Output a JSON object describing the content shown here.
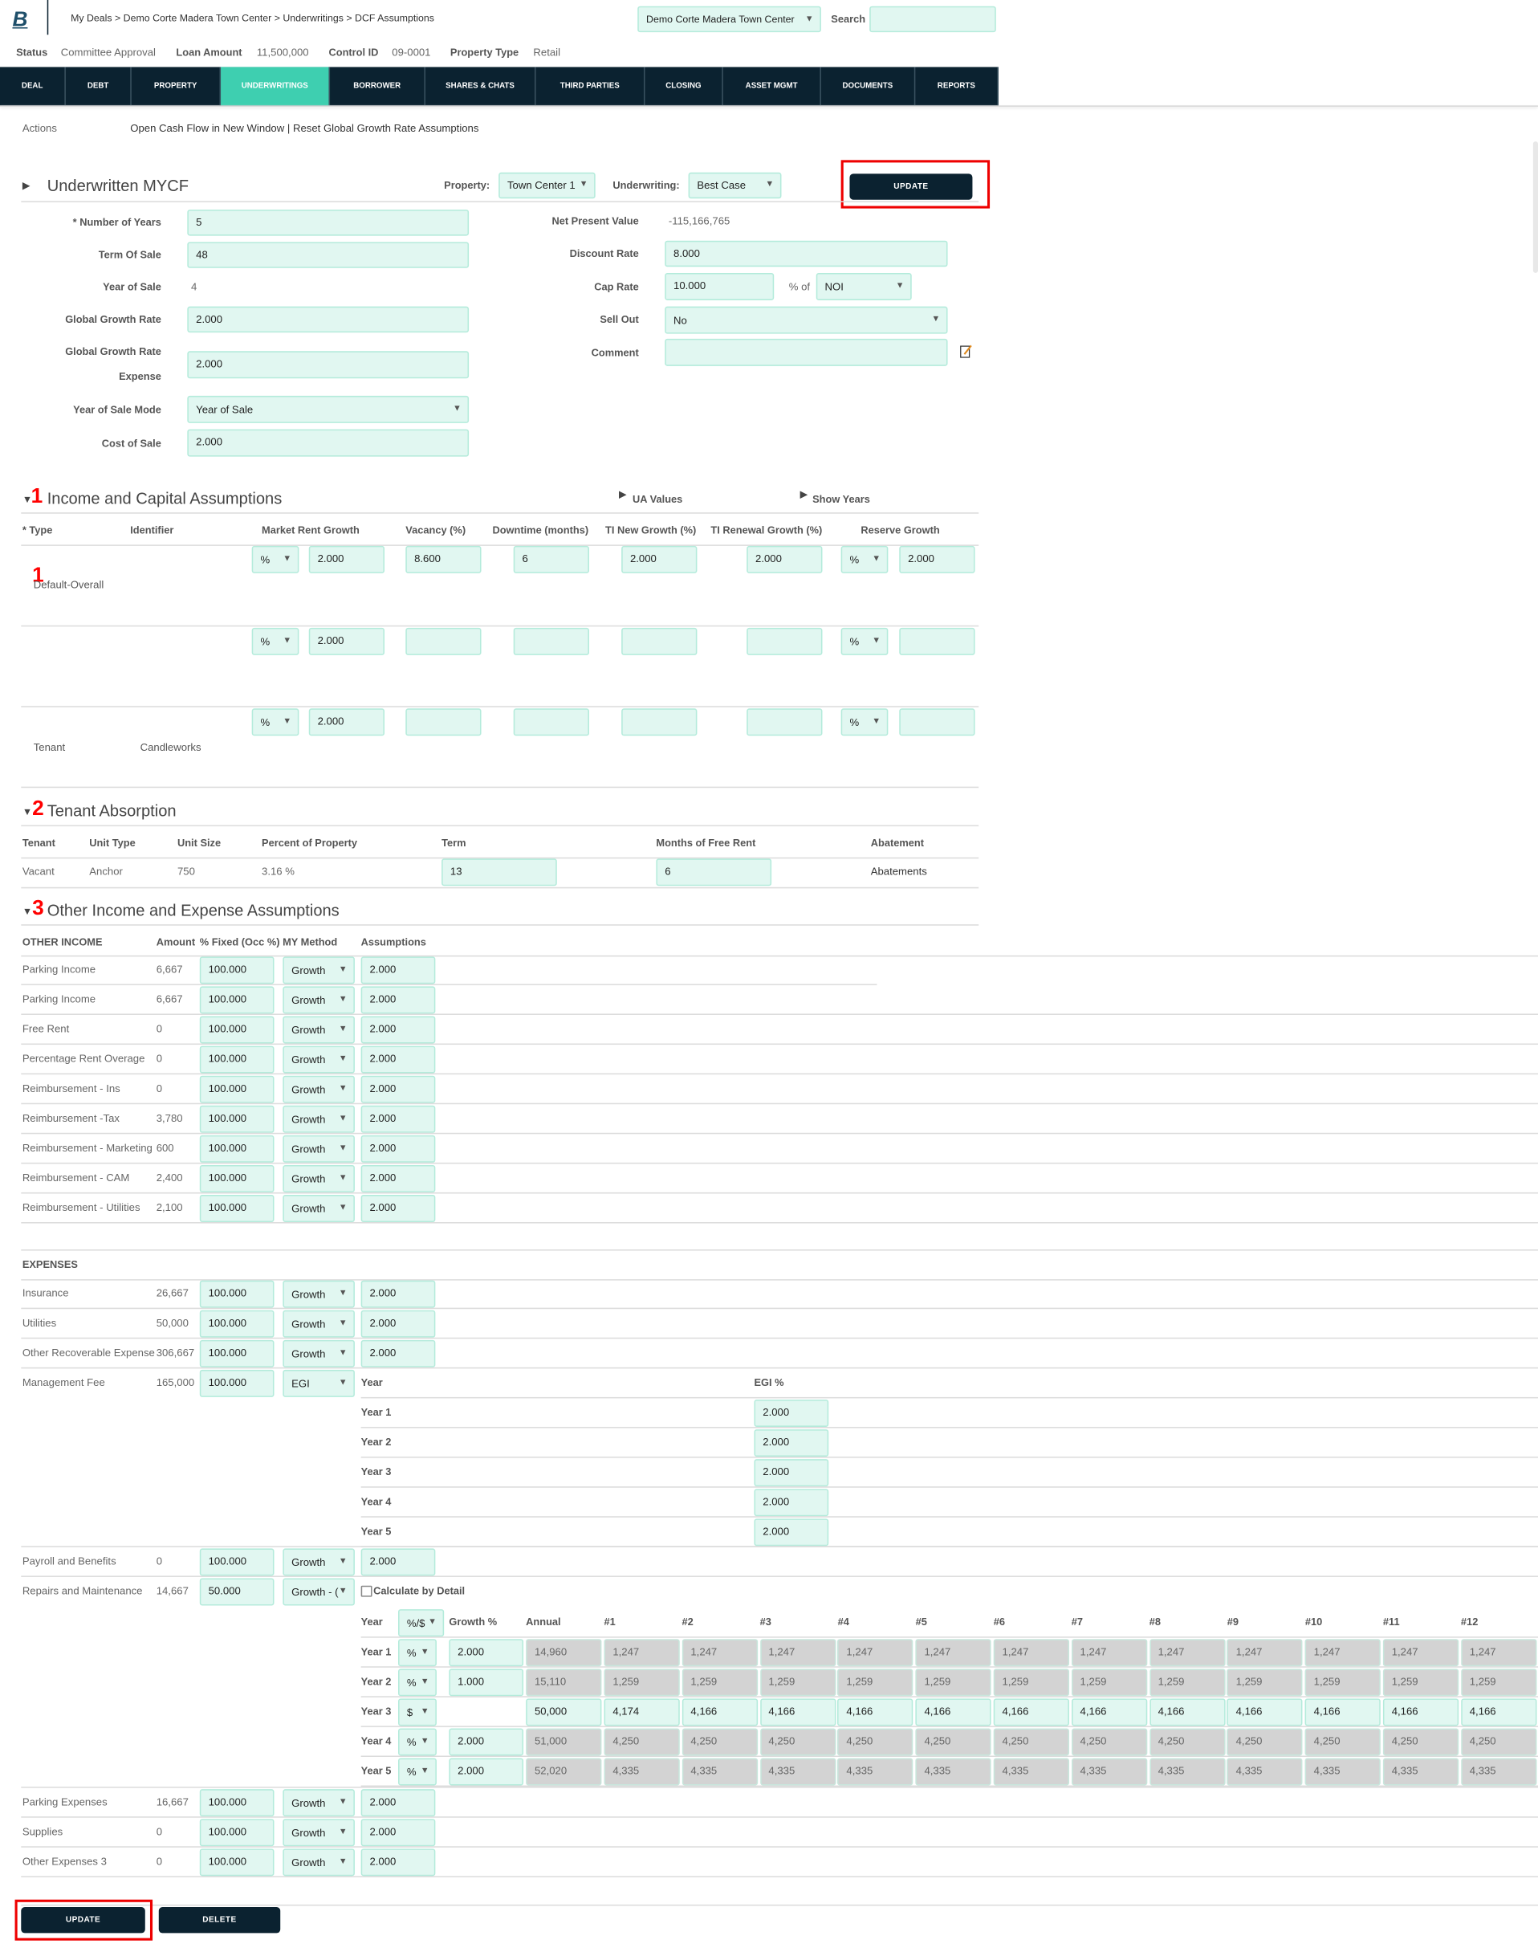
{
  "header": {
    "logo": "B",
    "breadcrumb": "My Deals > Demo Corte Madera Town Center > Underwritings > DCF Assumptions",
    "deal_select": "Demo Corte Madera Town Center",
    "search_label": "Search",
    "search_value": ""
  },
  "status_bar": {
    "status_label": "Status",
    "status_value": "Committee Approval",
    "loan_label": "Loan Amount",
    "loan_value": "11,500,000",
    "control_label": "Control ID",
    "control_value": "09-0001",
    "type_label": "Property Type",
    "type_value": "Retail"
  },
  "nav": {
    "tabs": [
      "DEAL",
      "DEBT",
      "PROPERTY",
      "UNDERWRITINGS",
      "BORROWER",
      "SHARES & CHATS",
      "THIRD PARTIES",
      "CLOSING",
      "ASSET MGMT",
      "DOCUMENTS",
      "REPORTS"
    ],
    "active": "UNDERWRITINGS"
  },
  "actions": {
    "label": "Actions",
    "open_cash_flow": "Open Cash Flow in New Window",
    "separator": "|",
    "reset_growth": "Reset Global Growth Rate Assumptions"
  },
  "mycf": {
    "title": "Underwritten MYCF",
    "property_label": "Property:",
    "property_value": "Town Center 1",
    "underwriting_label": "Underwriting:",
    "underwriting_value": "Best Case",
    "update_label": "UPDATE",
    "number_of_years_label": "* Number of Years",
    "number_of_years": "5",
    "term_of_sale_label": "Term Of Sale",
    "term_of_sale": "48",
    "year_of_sale_label": "Year of Sale",
    "year_of_sale": "4",
    "global_growth_label": "Global Growth Rate",
    "global_growth": "2.000",
    "global_growth_exp_label_1": "Global Growth Rate",
    "global_growth_exp_label_2": "Expense",
    "global_growth_exp": "2.000",
    "year_of_sale_mode_label": "Year of Sale Mode",
    "year_of_sale_mode": "Year of Sale",
    "cost_of_sale_label": "Cost of Sale",
    "cost_of_sale": "2.000",
    "npv_label": "Net Present Value",
    "npv": "-115,166,765",
    "discount_rate_label": "Discount Rate",
    "discount_rate": "8.000",
    "cap_rate_label": "Cap Rate",
    "cap_rate": "10.000",
    "cap_rate_of": "% of",
    "cap_rate_basis": "NOI",
    "sell_out_label": "Sell Out",
    "sell_out": "No",
    "comment_label": "Comment",
    "comment": "",
    "comment_icon": "edit-note-icon"
  },
  "annotations": {
    "one_a": "1",
    "one_b": "1",
    "two": "2",
    "three": "3"
  },
  "income_capital": {
    "title": "Income and Capital Assumptions",
    "ua_values": "UA Values",
    "show_years": "Show Years",
    "headers": [
      "* Type",
      "Identifier",
      "Market Rent Growth",
      "Vacancy (%)",
      "Downtime (months)",
      "TI New Growth (%)",
      "TI Renewal Growth (%)",
      "Reserve Growth"
    ],
    "rows": [
      {
        "type": "Default-Overall",
        "identifier": "",
        "mrg_unit": "%",
        "mrg": "2.000",
        "vacancy": "8.600",
        "downtime": "6",
        "ti_new": "2.000",
        "ti_renewal": "2.000",
        "reserve_unit": "%",
        "reserve": "2.000"
      },
      {
        "type": "",
        "identifier": "",
        "mrg_unit": "%",
        "mrg": "2.000",
        "vacancy": "",
        "downtime": "",
        "ti_new": "",
        "ti_renewal": "",
        "reserve_unit": "%",
        "reserve": ""
      },
      {
        "type": "Tenant",
        "identifier": "Candleworks",
        "mrg_unit": "%",
        "mrg": "2.000",
        "vacancy": "",
        "downtime": "",
        "ti_new": "",
        "ti_renewal": "",
        "reserve_unit": "%",
        "reserve": ""
      }
    ]
  },
  "tenant_absorption": {
    "title": "Tenant Absorption",
    "headers": [
      "Tenant",
      "Unit Type",
      "Unit Size",
      "Percent of Property",
      "Term",
      "Months of Free Rent",
      "Abatement"
    ],
    "row": {
      "tenant": "Vacant",
      "unit_type": "Anchor",
      "unit_size": "750",
      "percent": "3.16 %",
      "term": "13",
      "free_rent": "6",
      "abatement": "Abatements"
    }
  },
  "other_income_expense": {
    "title": "Other Income and Expense Assumptions",
    "income_header": "OTHER INCOME",
    "col_amount": "Amount",
    "col_fixed_method": "% Fixed (Occ %) MY Method",
    "col_assumptions": "Assumptions",
    "income": [
      {
        "name": "Parking Income",
        "amount": "6,667",
        "fixed": "100.000",
        "method": "Growth",
        "assumption": "2.000"
      },
      {
        "name": "Parking Income",
        "amount": "6,667",
        "fixed": "100.000",
        "method": "Growth",
        "assumption": "2.000"
      },
      {
        "name": "Free Rent",
        "amount": "0",
        "fixed": "100.000",
        "method": "Growth",
        "assumption": "2.000"
      },
      {
        "name": "Percentage Rent Overage",
        "amount": "0",
        "fixed": "100.000",
        "method": "Growth",
        "assumption": "2.000"
      },
      {
        "name": "Reimbursement - Ins",
        "amount": "0",
        "fixed": "100.000",
        "method": "Growth",
        "assumption": "2.000"
      },
      {
        "name": "Reimbursement -Tax",
        "amount": "3,780",
        "fixed": "100.000",
        "method": "Growth",
        "assumption": "2.000"
      },
      {
        "name": "Reimbursement - Marketing",
        "amount": "600",
        "fixed": "100.000",
        "method": "Growth",
        "assumption": "2.000"
      },
      {
        "name": "Reimbursement - CAM",
        "amount": "2,400",
        "fixed": "100.000",
        "method": "Growth",
        "assumption": "2.000"
      },
      {
        "name": "Reimbursement - Utilities",
        "amount": "2,100",
        "fixed": "100.000",
        "method": "Growth",
        "assumption": "2.000"
      }
    ],
    "expenses_header": "EXPENSES",
    "expenses_a": [
      {
        "name": "Insurance",
        "amount": "26,667",
        "fixed": "100.000",
        "method": "Growth",
        "assumption": "2.000"
      },
      {
        "name": "Utilities",
        "amount": "50,000",
        "fixed": "100.000",
        "method": "Growth",
        "assumption": "2.000"
      },
      {
        "name": "Other Recoverable Expense",
        "amount": "306,667",
        "fixed": "100.000",
        "method": "Growth",
        "assumption": "2.000"
      }
    ],
    "management_fee": {
      "name": "Management Fee",
      "amount": "165,000",
      "fixed": "100.000",
      "method": "EGI",
      "year_header": "Year",
      "egi_header": "EGI %",
      "years": [
        {
          "year": "Year 1",
          "egi": "2.000"
        },
        {
          "year": "Year 2",
          "egi": "2.000"
        },
        {
          "year": "Year 3",
          "egi": "2.000"
        },
        {
          "year": "Year 4",
          "egi": "2.000"
        },
        {
          "year": "Year 5",
          "egi": "2.000"
        }
      ]
    },
    "payroll": {
      "name": "Payroll and Benefits",
      "amount": "0",
      "fixed": "100.000",
      "method": "Growth",
      "assumption": "2.000"
    },
    "repairs": {
      "name": "Repairs and Maintenance",
      "amount": "14,667",
      "fixed": "50.000",
      "method": "Growth - (",
      "calc_by_detail_label": "Calculate by Detail",
      "calc_by_detail_checked": false,
      "detail": {
        "headers": {
          "year": "Year",
          "mode": "%/$",
          "growth": "Growth %",
          "annual": "Annual",
          "months": [
            "#1",
            "#2",
            "#3",
            "#4",
            "#5",
            "#6",
            "#7",
            "#8",
            "#9",
            "#10",
            "#11",
            "#12"
          ]
        },
        "rows": [
          {
            "year": "Year 1",
            "mode": "%",
            "growth": "2.000",
            "annual": "14,960",
            "editable": false,
            "months": [
              "1,247",
              "1,247",
              "1,247",
              "1,247",
              "1,247",
              "1,247",
              "1,247",
              "1,247",
              "1,247",
              "1,247",
              "1,247",
              "1,247"
            ]
          },
          {
            "year": "Year 2",
            "mode": "%",
            "growth": "1.000",
            "annual": "15,110",
            "editable": false,
            "months": [
              "1,259",
              "1,259",
              "1,259",
              "1,259",
              "1,259",
              "1,259",
              "1,259",
              "1,259",
              "1,259",
              "1,259",
              "1,259",
              "1,259"
            ]
          },
          {
            "year": "Year 3",
            "mode": "$",
            "growth": "",
            "annual": "50,000",
            "editable": true,
            "months": [
              "4,174",
              "4,166",
              "4,166",
              "4,166",
              "4,166",
              "4,166",
              "4,166",
              "4,166",
              "4,166",
              "4,166",
              "4,166",
              "4,166"
            ]
          },
          {
            "year": "Year 4",
            "mode": "%",
            "growth": "2.000",
            "annual": "51,000",
            "editable": false,
            "months": [
              "4,250",
              "4,250",
              "4,250",
              "4,250",
              "4,250",
              "4,250",
              "4,250",
              "4,250",
              "4,250",
              "4,250",
              "4,250",
              "4,250"
            ]
          },
          {
            "year": "Year 5",
            "mode": "%",
            "growth": "2.000",
            "annual": "52,020",
            "editable": false,
            "months": [
              "4,335",
              "4,335",
              "4,335",
              "4,335",
              "4,335",
              "4,335",
              "4,335",
              "4,335",
              "4,335",
              "4,335",
              "4,335",
              "4,335"
            ]
          }
        ]
      }
    },
    "expenses_b": [
      {
        "name": "Parking Expenses",
        "amount": "16,667",
        "fixed": "100.000",
        "method": "Growth",
        "assumption": "2.000"
      },
      {
        "name": "Supplies",
        "amount": "0",
        "fixed": "100.000",
        "method": "Growth",
        "assumption": "2.000"
      },
      {
        "name": "Other Expenses 3",
        "amount": "0",
        "fixed": "100.000",
        "method": "Growth",
        "assumption": "2.000"
      }
    ]
  },
  "footer": {
    "update_label": "UPDATE",
    "delete_label": "DELETE"
  },
  "colors": {
    "nav_bg": "#0b2230",
    "active_tab": "#3ecfb0",
    "input_bg": "#e1f7f1",
    "readonly_cell": "#d3d3d3",
    "annotation": "#ff0000"
  }
}
